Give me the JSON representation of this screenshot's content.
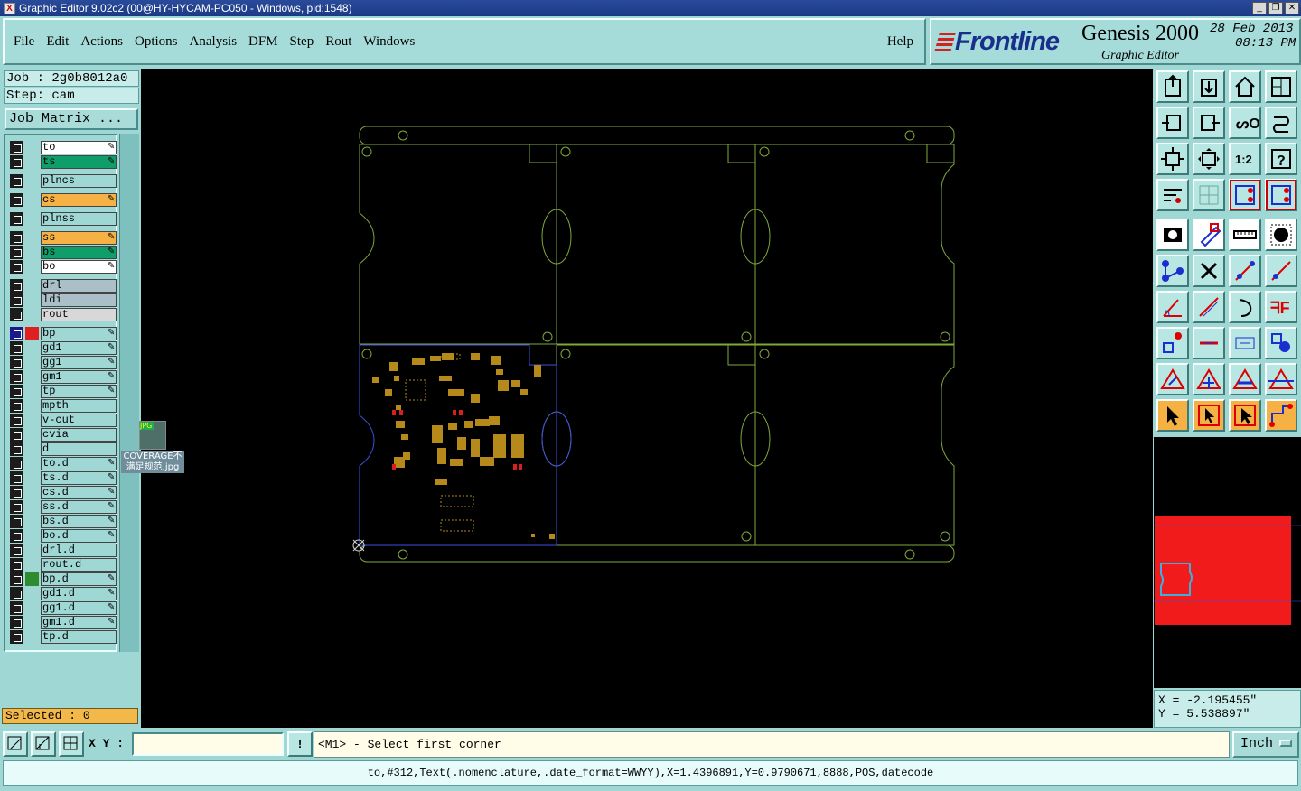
{
  "window": {
    "title": "Graphic Editor 9.02c2 (00@HY-HYCAM-PC050 - Windows, pid:1548)"
  },
  "menu": {
    "items": [
      "File",
      "Edit",
      "Actions",
      "Options",
      "Analysis",
      "DFM",
      "Step",
      "Rout",
      "Windows"
    ],
    "help": "Help"
  },
  "brand": {
    "logo": "Frontline",
    "product": "Genesis 2000",
    "subtitle": "Graphic Editor",
    "date": "28 Feb 2013",
    "time": "08:13 PM"
  },
  "job": {
    "job_line": "Job : 2g0b8012a0",
    "step_line": "Step: cam",
    "matrix_button": "Job Matrix ..."
  },
  "layers": [
    {
      "name": "to",
      "color": "#ffffff",
      "pen": true
    },
    {
      "name": "ts",
      "color": "#0f9e6a",
      "pen": true
    },
    {
      "name": "plncs",
      "color": "#9fd7d5",
      "pen": false
    },
    {
      "name": "cs",
      "color": "#f5b144",
      "pen": true
    },
    {
      "name": "plnss",
      "color": "#9fd7d5",
      "pen": false
    },
    {
      "name": "ss",
      "color": "#f5b144",
      "pen": true
    },
    {
      "name": "bs",
      "color": "#0f9e6a",
      "pen": true
    },
    {
      "name": "bo",
      "color": "#ffffff",
      "pen": true
    },
    {
      "name": "drl",
      "color": "#aabfc8",
      "pen": false
    },
    {
      "name": "ldi",
      "color": "#aabfc8",
      "pen": false
    },
    {
      "name": "rout",
      "color": "#d8d8d8",
      "pen": false
    },
    {
      "name": "bp",
      "color": "#9fd7d5",
      "pen": true,
      "swatch": "#e02020",
      "active": true
    },
    {
      "name": "gd1",
      "color": "#9fd7d5",
      "pen": true
    },
    {
      "name": "gg1",
      "color": "#9fd7d5",
      "pen": true
    },
    {
      "name": "gm1",
      "color": "#9fd7d5",
      "pen": true
    },
    {
      "name": "tp",
      "color": "#9fd7d5",
      "pen": true
    },
    {
      "name": "mpth",
      "color": "#9fd7d5",
      "pen": false
    },
    {
      "name": "v-cut",
      "color": "#9fd7d5",
      "pen": false
    },
    {
      "name": "cvia",
      "color": "#9fd7d5",
      "pen": false
    },
    {
      "name": "d",
      "color": "#9fd7d5",
      "pen": false
    },
    {
      "name": "to.d",
      "color": "#9fd7d5",
      "pen": true
    },
    {
      "name": "ts.d",
      "color": "#9fd7d5",
      "pen": true
    },
    {
      "name": "cs.d",
      "color": "#9fd7d5",
      "pen": true
    },
    {
      "name": "ss.d",
      "color": "#9fd7d5",
      "pen": true
    },
    {
      "name": "bs.d",
      "color": "#9fd7d5",
      "pen": true
    },
    {
      "name": "bo.d",
      "color": "#9fd7d5",
      "pen": true
    },
    {
      "name": "drl.d",
      "color": "#9fd7d5",
      "pen": false
    },
    {
      "name": "rout.d",
      "color": "#9fd7d5",
      "pen": false
    },
    {
      "name": "bp.d",
      "color": "#9fd7d5",
      "pen": true,
      "swatch": "#2e8b2e"
    },
    {
      "name": "gd1.d",
      "color": "#9fd7d5",
      "pen": true
    },
    {
      "name": "gg1.d",
      "color": "#9fd7d5",
      "pen": true
    },
    {
      "name": "gm1.d",
      "color": "#9fd7d5",
      "pen": true
    },
    {
      "name": "tp.d",
      "color": "#9fd7d5",
      "pen": false
    }
  ],
  "selected": "Selected : 0",
  "desktop_icon": {
    "label": "COVERAGE不满足规范.jpg",
    "badge": "JPG"
  },
  "coords": {
    "x": "X = -2.195455\"",
    "y": "Y = 5.538897\""
  },
  "bottom": {
    "xy_label": "X Y :",
    "xy_value": "",
    "prompt": "<M1> - Select first corner",
    "unit": "Inch",
    "alert_icon": "!"
  },
  "status_line": "to,#312,Text(.nomenclature,.date_format=WWYY),X=1.4396891,Y=0.9790671,8888,POS,datecode",
  "toolbar_rows_1": [
    [
      "open-icon",
      "save-icon",
      "home-icon",
      "panel-icon"
    ],
    [
      "pan-left-icon",
      "pan-right-icon",
      "undo-icon",
      "redo-icon"
    ],
    [
      "fit-icon",
      "zoom-fit-icon",
      "scale-1-2-icon",
      "help-icon"
    ],
    [
      "tool-options-icon",
      "grid-icon",
      "snap-red-icon",
      "snap-red2-icon"
    ]
  ],
  "toolbar_rows_2": [
    [
      "camera-icon",
      "erase-icon",
      "ruler-icon",
      "pad-icon"
    ],
    [
      "net-icon",
      "cross-icon",
      "line-point-icon",
      "line-point2-icon"
    ],
    [
      "angle-icon",
      "slope-icon",
      "arc-icon",
      "flip-icon"
    ],
    [
      "measure-icon",
      "minus-icon",
      "dim-icon",
      "shapes-icon"
    ],
    [
      "tri-icon",
      "tri2-icon",
      "tri3-icon",
      "tri4-icon"
    ],
    [
      "select-icon",
      "select2-icon",
      "select3-icon",
      "route-icon"
    ]
  ],
  "scale_label": "1:2"
}
